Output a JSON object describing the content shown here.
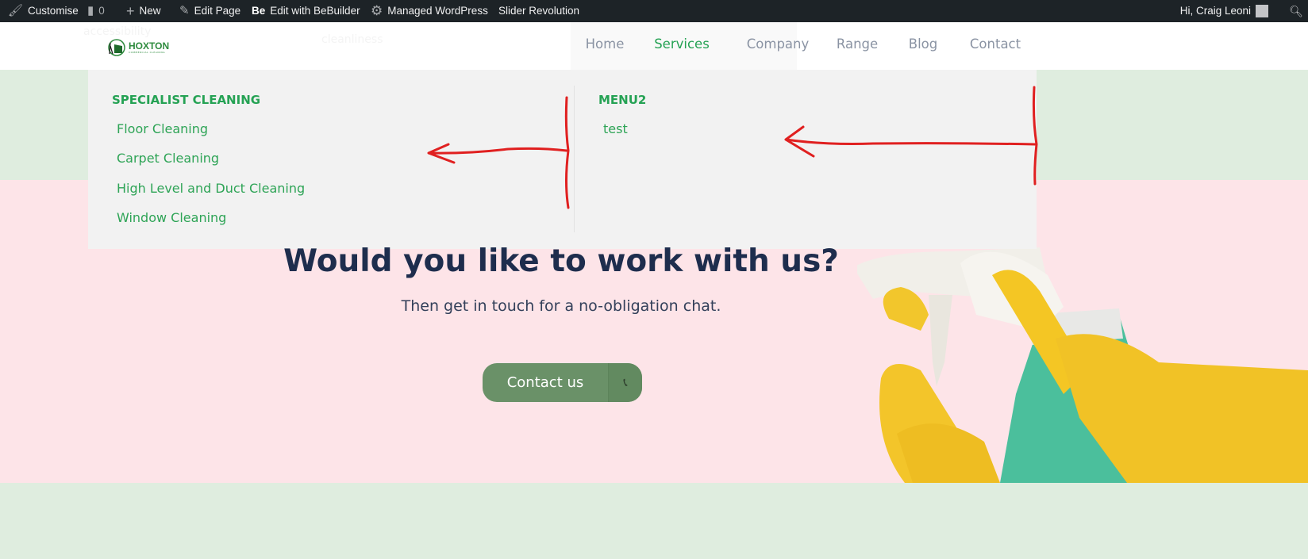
{
  "admin_bar": {
    "items": [
      {
        "icon": "brush-icon",
        "label": "Customise"
      },
      {
        "icon": "comment-icon",
        "label": "0"
      },
      {
        "icon": "plus-icon",
        "label": "New"
      },
      {
        "icon": "pencil-icon",
        "label": "Edit Page"
      },
      {
        "icon": "bebuilder-icon",
        "icon_text": "Be",
        "label": "Edit with BeBuilder"
      },
      {
        "icon": "gear-icon",
        "label": "Managed WordPress"
      },
      {
        "icon": null,
        "label": "Slider Revolution"
      }
    ],
    "greeting": "Hi, Craig Leoni"
  },
  "header": {
    "logo_text": "HOXTON",
    "logo_subtext": "COMMERCIAL CLEANING",
    "ghost_texts": [
      "accessibility",
      "cleanliness"
    ],
    "nav": [
      {
        "label": "Home",
        "active": false
      },
      {
        "label": "Services",
        "active": true
      },
      {
        "label": "Company",
        "active": false
      },
      {
        "label": "Range",
        "active": false
      },
      {
        "label": "Blog",
        "active": false
      },
      {
        "label": "Contact",
        "active": false
      }
    ]
  },
  "mega_menu": {
    "columns": [
      {
        "heading": "SPECIALIST CLEANING",
        "items": [
          "Floor Cleaning",
          "Carpet Cleaning",
          "High Level and Duct Cleaning",
          "Window Cleaning"
        ]
      },
      {
        "heading": "MENU2",
        "items": [
          "test"
        ]
      }
    ]
  },
  "cta_section": {
    "heading": "Would you like to work with us?",
    "subheading": "Then get in touch for a no-obligation chat.",
    "button_label": "Contact us",
    "button_icon": "phone-icon"
  },
  "colors": {
    "accent": "#25a254",
    "button": "#6a9168",
    "heading": "#1e2d4d",
    "annotation": "#e02020"
  }
}
